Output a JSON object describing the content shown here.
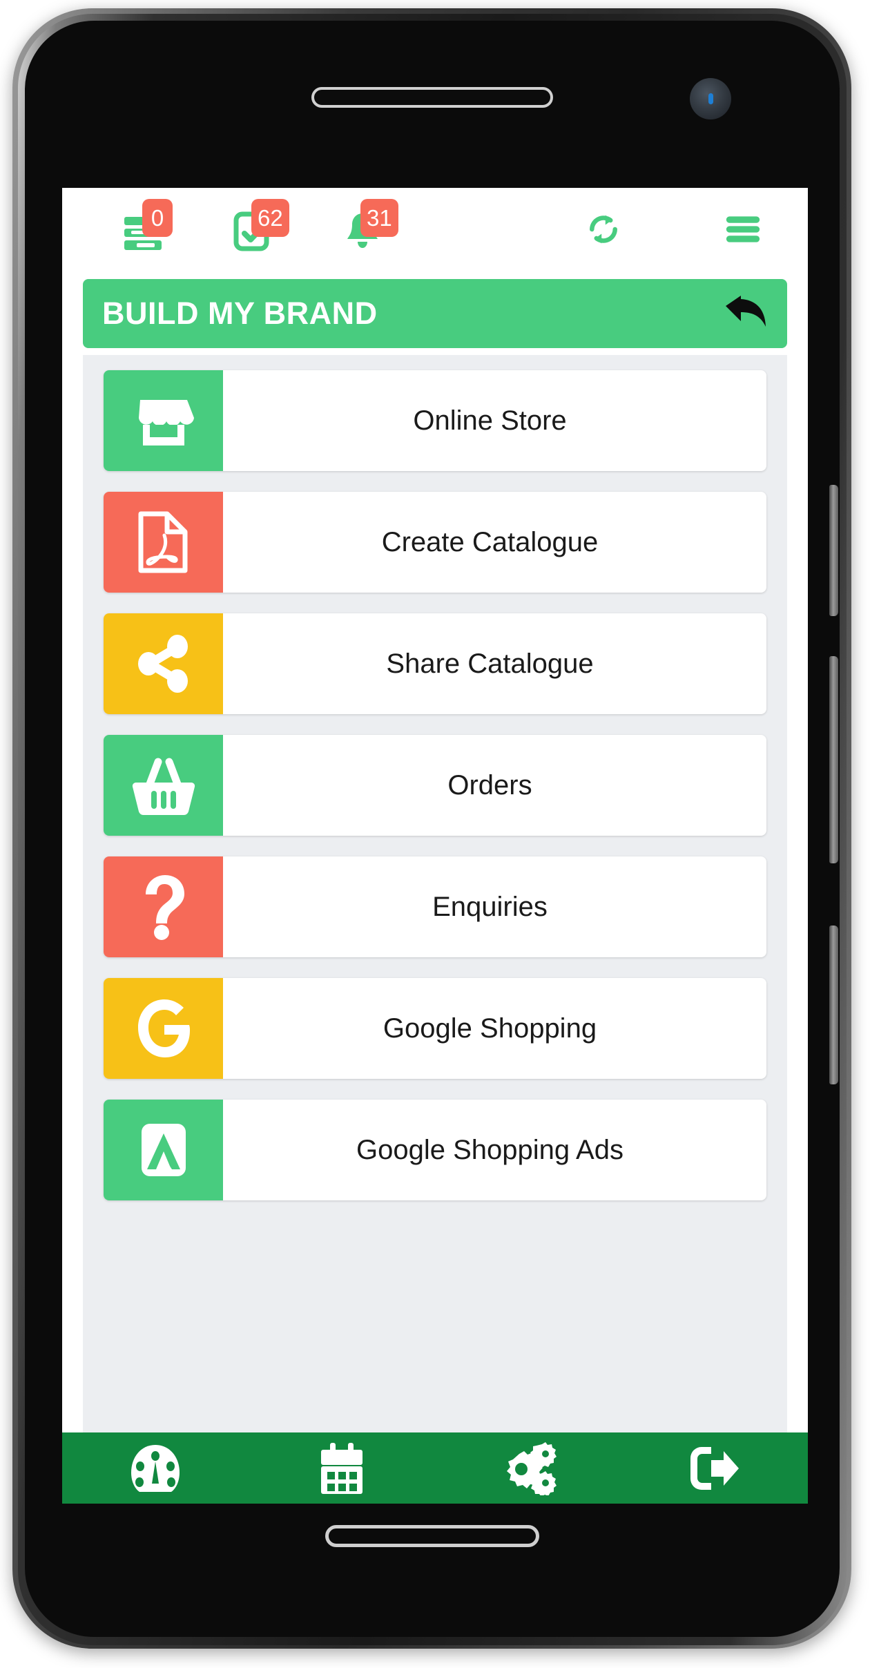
{
  "app": {
    "screen_title": "BUILD MY BRAND",
    "accent_green": "#48cc7f",
    "badge_red": "#f66a58",
    "nav_green": "#11883f",
    "yellow": "#f7c117",
    "panel_bg": "#eceef1"
  },
  "topbar": {
    "icons": [
      {
        "name": "stacked-list-icon",
        "badge": "0"
      },
      {
        "name": "task-checklist-icon",
        "badge": "62"
      },
      {
        "name": "notification-bell-icon",
        "badge": "31"
      }
    ],
    "refresh_label": "Refresh",
    "menu_label": "Menu"
  },
  "header": {
    "title": "BUILD MY BRAND",
    "back_label": "Back"
  },
  "menu": {
    "items": [
      {
        "label": "Online Store",
        "icon": "storefront-icon",
        "color": "#48cc7f"
      },
      {
        "label": "Create Catalogue",
        "icon": "pdf-file-icon",
        "color": "#f66a58"
      },
      {
        "label": "Share Catalogue",
        "icon": "share-nodes-icon",
        "color": "#f7c117"
      },
      {
        "label": "Orders",
        "icon": "shopping-basket-icon",
        "color": "#48cc7f"
      },
      {
        "label": "Enquiries",
        "icon": "question-mark-icon",
        "color": "#f66a58"
      },
      {
        "label": "Google Shopping",
        "icon": "google-g-icon",
        "color": "#f7c117"
      },
      {
        "label": "Google Shopping Ads",
        "icon": "adwords-a-icon",
        "color": "#48cc7f"
      }
    ]
  },
  "bottom_nav": {
    "items": [
      {
        "label": "Dashboard",
        "icon": "speedometer-icon"
      },
      {
        "label": "Calendar",
        "icon": "calendar-icon"
      },
      {
        "label": "Settings",
        "icon": "gears-icon"
      },
      {
        "label": "Logout",
        "icon": "logout-icon"
      }
    ]
  }
}
